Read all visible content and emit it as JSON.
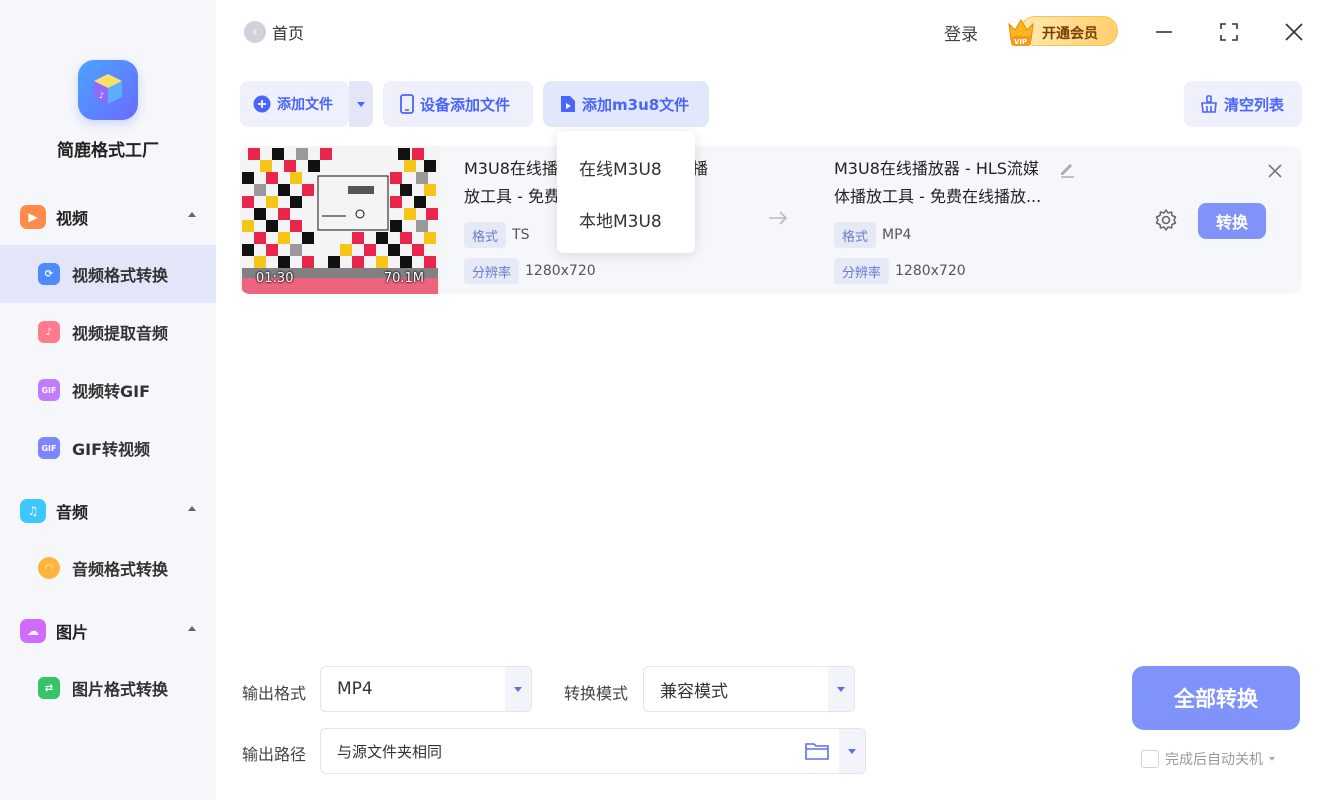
{
  "app": {
    "name": "简鹿格式工厂",
    "accent_color": "#4a64ff",
    "button_color": "#7f93fb"
  },
  "header": {
    "back_label": "首页",
    "login_label": "登录",
    "vip_label": "开通会员",
    "vip_badge_text": "VIP"
  },
  "sidebar": {
    "sections": [
      {
        "label": "视频",
        "icon": "video-icon",
        "color": "#ff8a4c",
        "items": [
          {
            "label": "视频格式转换",
            "icon": "video-convert-icon",
            "active": true
          },
          {
            "label": "视频提取音频",
            "icon": "music-note-icon"
          },
          {
            "label": "视频转GIF",
            "icon": "gif-icon"
          },
          {
            "label": "GIF转视频",
            "icon": "gif-video-icon"
          }
        ]
      },
      {
        "label": "音频",
        "icon": "audio-icon",
        "color": "#3ec6ff",
        "items": [
          {
            "label": "音频格式转换",
            "icon": "headphones-icon"
          }
        ]
      },
      {
        "label": "图片",
        "icon": "image-icon",
        "color": "#d06bff",
        "items": [
          {
            "label": "图片格式转换",
            "icon": "image-convert-icon"
          }
        ]
      }
    ]
  },
  "toolbar": {
    "add_file": "添加文件",
    "device_add": "设备添加文件",
    "add_m3u8": "添加m3u8文件",
    "clear_list": "清空列表"
  },
  "dropdown": {
    "items": [
      "在线M3U8",
      "本地M3U8"
    ]
  },
  "file": {
    "duration": "01:30",
    "size": "70.1M",
    "source": {
      "name_line1": "M3U8在线播",
      "name_line1_tail": "放器 - HLS流媒体播",
      "name_line2": "放工具 - 免费",
      "format_tag": "格式",
      "format": "TS",
      "resolution_tag": "分辨率",
      "resolution": "1280x720"
    },
    "target": {
      "name_line1": "M3U8在线播放器 - HLS流媒",
      "name_line2": "体播放工具 - 免费在线播放...",
      "format_tag": "格式",
      "format": "MP4",
      "resolution_tag": "分辨率",
      "resolution": "1280x720"
    },
    "convert_label": "转换"
  },
  "output": {
    "format_label": "输出格式",
    "format_value": "MP4",
    "mode_label": "转换模式",
    "mode_value": "兼容模式",
    "path_label": "输出路径",
    "path_value": "与源文件夹相同",
    "convert_all": "全部转换",
    "auto_shutdown": "完成后自动关机"
  }
}
